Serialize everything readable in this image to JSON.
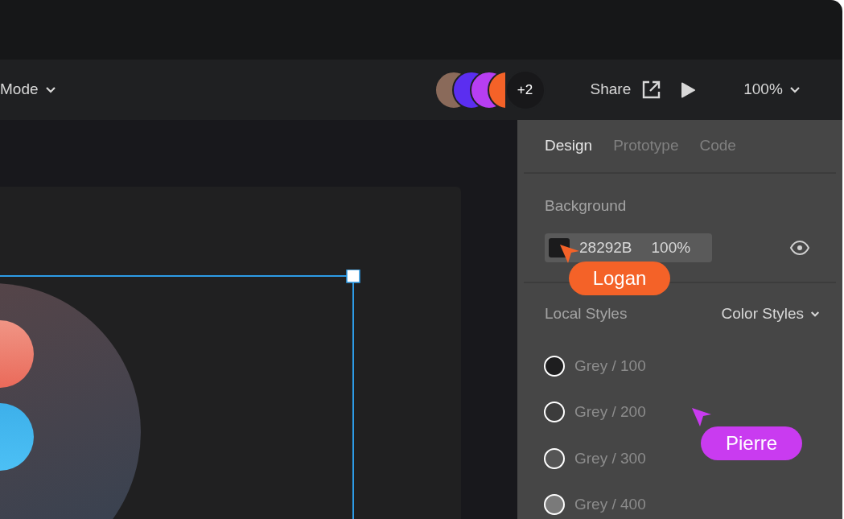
{
  "toolbar": {
    "mode_label": "Mode",
    "avatars": [
      {
        "kind": "photo",
        "color": "#8a6a5a"
      },
      {
        "kind": "initial",
        "color": "#5b2ef0"
      },
      {
        "kind": "initial",
        "color": "#b73ef2"
      },
      {
        "kind": "initial",
        "color": "#f46228"
      },
      {
        "kind": "count",
        "text": "+2",
        "color": "#18181a"
      }
    ],
    "share_label": "Share",
    "zoom_label": "100%"
  },
  "panel": {
    "tabs": [
      {
        "label": "Design",
        "selected": true
      },
      {
        "label": "Prototype",
        "selected": false
      },
      {
        "label": "Code",
        "selected": false
      }
    ],
    "background": {
      "heading": "Background",
      "hex": "28292B",
      "opacity": "100%",
      "visible": true
    },
    "local_styles": {
      "heading": "Local Styles",
      "dropdown": "Color Styles",
      "styles": [
        {
          "name": "Grey / 100",
          "color": "#1e1e1f"
        },
        {
          "name": "Grey / 200",
          "color": "#3c3c3c"
        },
        {
          "name": "Grey / 300",
          "color": "#555555"
        },
        {
          "name": "Grey / 400",
          "color": "#7a7a7a"
        }
      ]
    }
  },
  "cursors": [
    {
      "name": "Logan",
      "color": "#f46228"
    },
    {
      "name": "Pierre",
      "color": "#c93bf0"
    }
  ]
}
